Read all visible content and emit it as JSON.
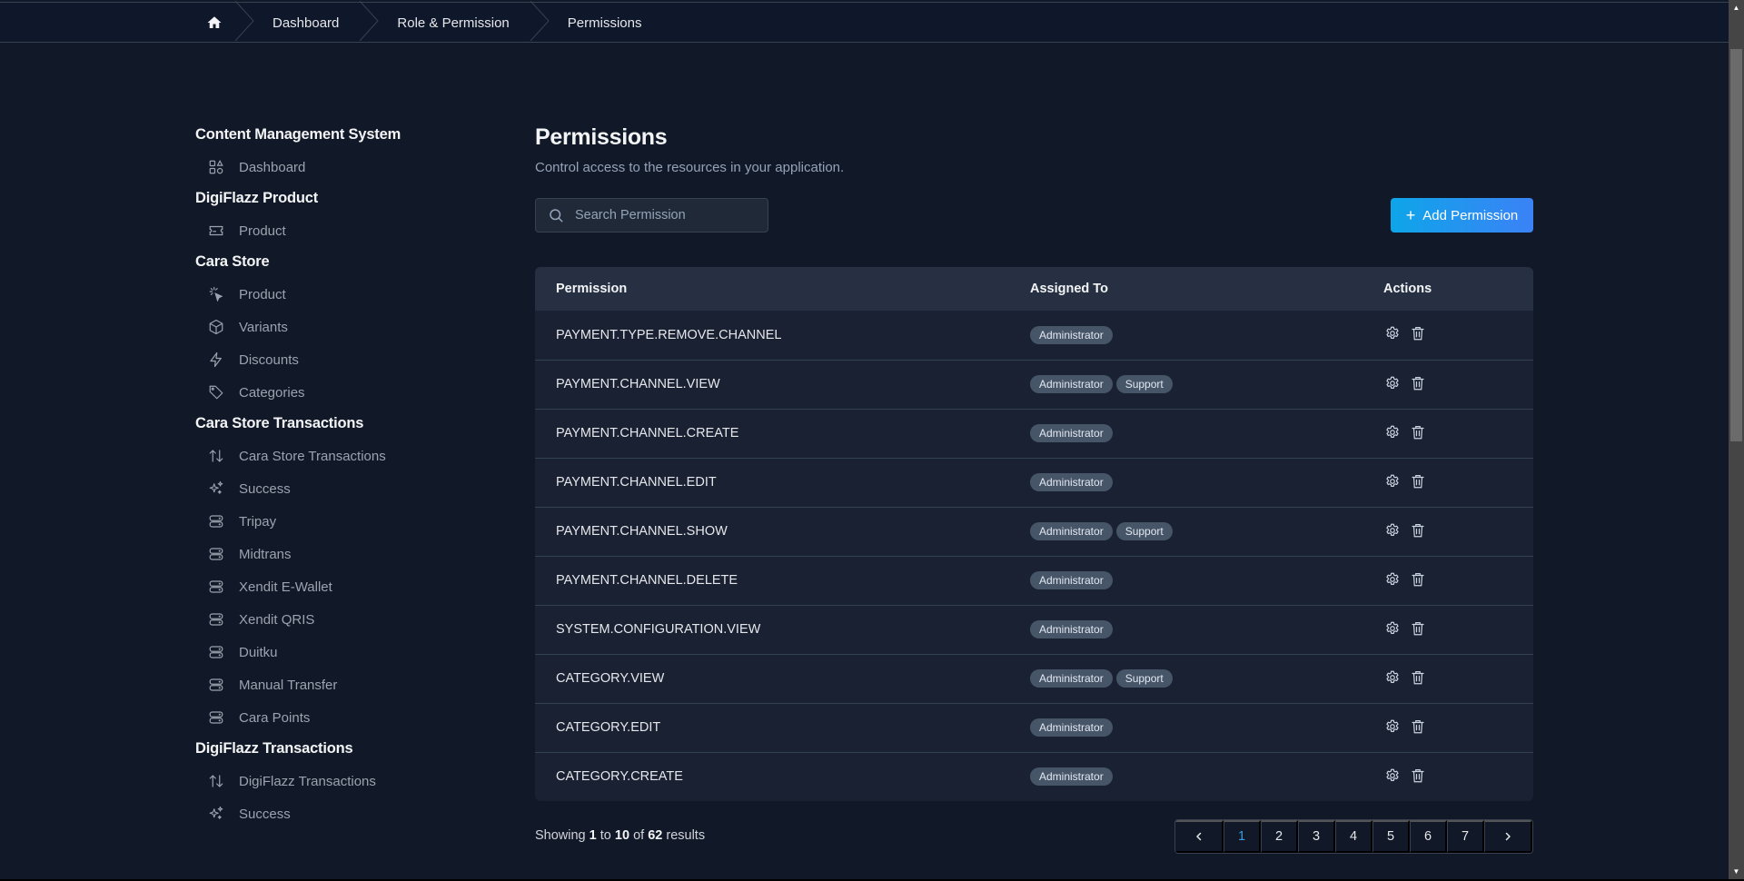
{
  "breadcrumb": {
    "home_icon": "home-icon",
    "items": [
      {
        "label": "Dashboard"
      },
      {
        "label": "Role & Permission"
      },
      {
        "label": "Permissions"
      }
    ]
  },
  "sidebar": {
    "sections": [
      {
        "title": "Content Management System",
        "items": [
          {
            "label": "Dashboard",
            "icon": "dashboard-grid-icon"
          }
        ]
      },
      {
        "title": "DigiFlazz Product",
        "items": [
          {
            "label": "Product",
            "icon": "ticket-icon"
          }
        ]
      },
      {
        "title": "Cara Store",
        "items": [
          {
            "label": "Product",
            "icon": "cursor-click-icon"
          },
          {
            "label": "Variants",
            "icon": "cube-icon"
          },
          {
            "label": "Discounts",
            "icon": "bolt-icon"
          },
          {
            "label": "Categories",
            "icon": "tag-icon"
          }
        ]
      },
      {
        "title": "Cara Store Transactions",
        "items": [
          {
            "label": "Cara Store Transactions",
            "icon": "arrows-up-down-icon"
          },
          {
            "label": "Success",
            "icon": "sparkles-icon"
          },
          {
            "label": "Tripay",
            "icon": "server-stack-icon"
          },
          {
            "label": "Midtrans",
            "icon": "server-stack-icon"
          },
          {
            "label": "Xendit E-Wallet",
            "icon": "server-stack-icon"
          },
          {
            "label": "Xendit QRIS",
            "icon": "server-stack-icon"
          },
          {
            "label": "Duitku",
            "icon": "server-stack-icon"
          },
          {
            "label": "Manual Transfer",
            "icon": "server-stack-icon"
          },
          {
            "label": "Cara Points",
            "icon": "server-stack-icon"
          }
        ]
      },
      {
        "title": "DigiFlazz Transactions",
        "items": [
          {
            "label": "DigiFlazz Transactions",
            "icon": "arrows-up-down-icon"
          },
          {
            "label": "Success",
            "icon": "sparkles-icon"
          }
        ]
      }
    ]
  },
  "main": {
    "title": "Permissions",
    "subtitle": "Control access to the resources in your application.",
    "search": {
      "placeholder": "Search Permission",
      "value": ""
    },
    "add_button": {
      "label": "Add Permission",
      "icon": "plus-icon"
    },
    "accent_gradient": [
      "#0ea5e9",
      "#3b82f6"
    ]
  },
  "table": {
    "columns": [
      "Permission",
      "Assigned To",
      "Actions"
    ],
    "rows": [
      {
        "permission": "PAYMENT.TYPE.REMOVE.CHANNEL",
        "roles": [
          "Administrator"
        ]
      },
      {
        "permission": "PAYMENT.CHANNEL.VIEW",
        "roles": [
          "Administrator",
          "Support"
        ]
      },
      {
        "permission": "PAYMENT.CHANNEL.CREATE",
        "roles": [
          "Administrator"
        ]
      },
      {
        "permission": "PAYMENT.CHANNEL.EDIT",
        "roles": [
          "Administrator"
        ]
      },
      {
        "permission": "PAYMENT.CHANNEL.SHOW",
        "roles": [
          "Administrator",
          "Support"
        ]
      },
      {
        "permission": "PAYMENT.CHANNEL.DELETE",
        "roles": [
          "Administrator"
        ]
      },
      {
        "permission": "SYSTEM.CONFIGURATION.VIEW",
        "roles": [
          "Administrator"
        ]
      },
      {
        "permission": "CATEGORY.VIEW",
        "roles": [
          "Administrator",
          "Support"
        ]
      },
      {
        "permission": "CATEGORY.EDIT",
        "roles": [
          "Administrator"
        ]
      },
      {
        "permission": "CATEGORY.CREATE",
        "roles": [
          "Administrator"
        ]
      }
    ],
    "row_actions": [
      "settings-gear-icon",
      "trash-icon"
    ]
  },
  "pagination": {
    "showing_prefix": "Showing",
    "from": "1",
    "to_word": "to",
    "to": "10",
    "of_word": "of",
    "total": "62",
    "suffix": "results",
    "pages": [
      "1",
      "2",
      "3",
      "4",
      "5",
      "6",
      "7"
    ],
    "current_page": "1",
    "active_color": "#3b9ae0"
  }
}
